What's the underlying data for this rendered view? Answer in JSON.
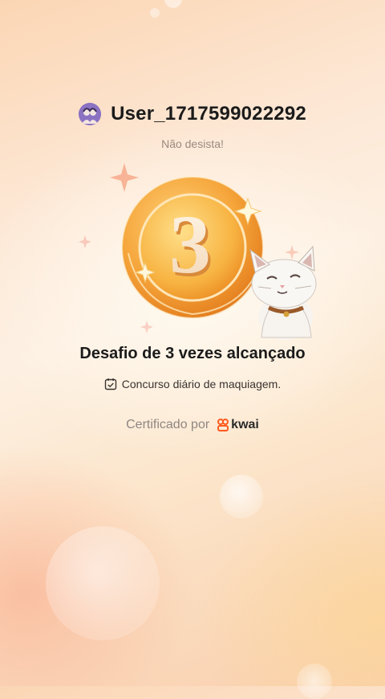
{
  "user": {
    "name": "User_1717599022292",
    "avatar_icon": "avatar-icon"
  },
  "subtitle": "Não desista!",
  "badge": {
    "number": "3",
    "icon": "medal-icon",
    "mascot": "cat-mascot"
  },
  "title": "Desafio de 3 vezes alcançado",
  "contest": {
    "icon": "calendar-check-icon",
    "label": "Concurso diário de maquiagem."
  },
  "certified": {
    "label": "Certificado por",
    "brand": "kwai",
    "brand_icon": "kwai-logo-icon"
  },
  "colors": {
    "accent": "#ef8a1e",
    "brand": "#ff5a1f",
    "text": "#1b1b1b"
  }
}
